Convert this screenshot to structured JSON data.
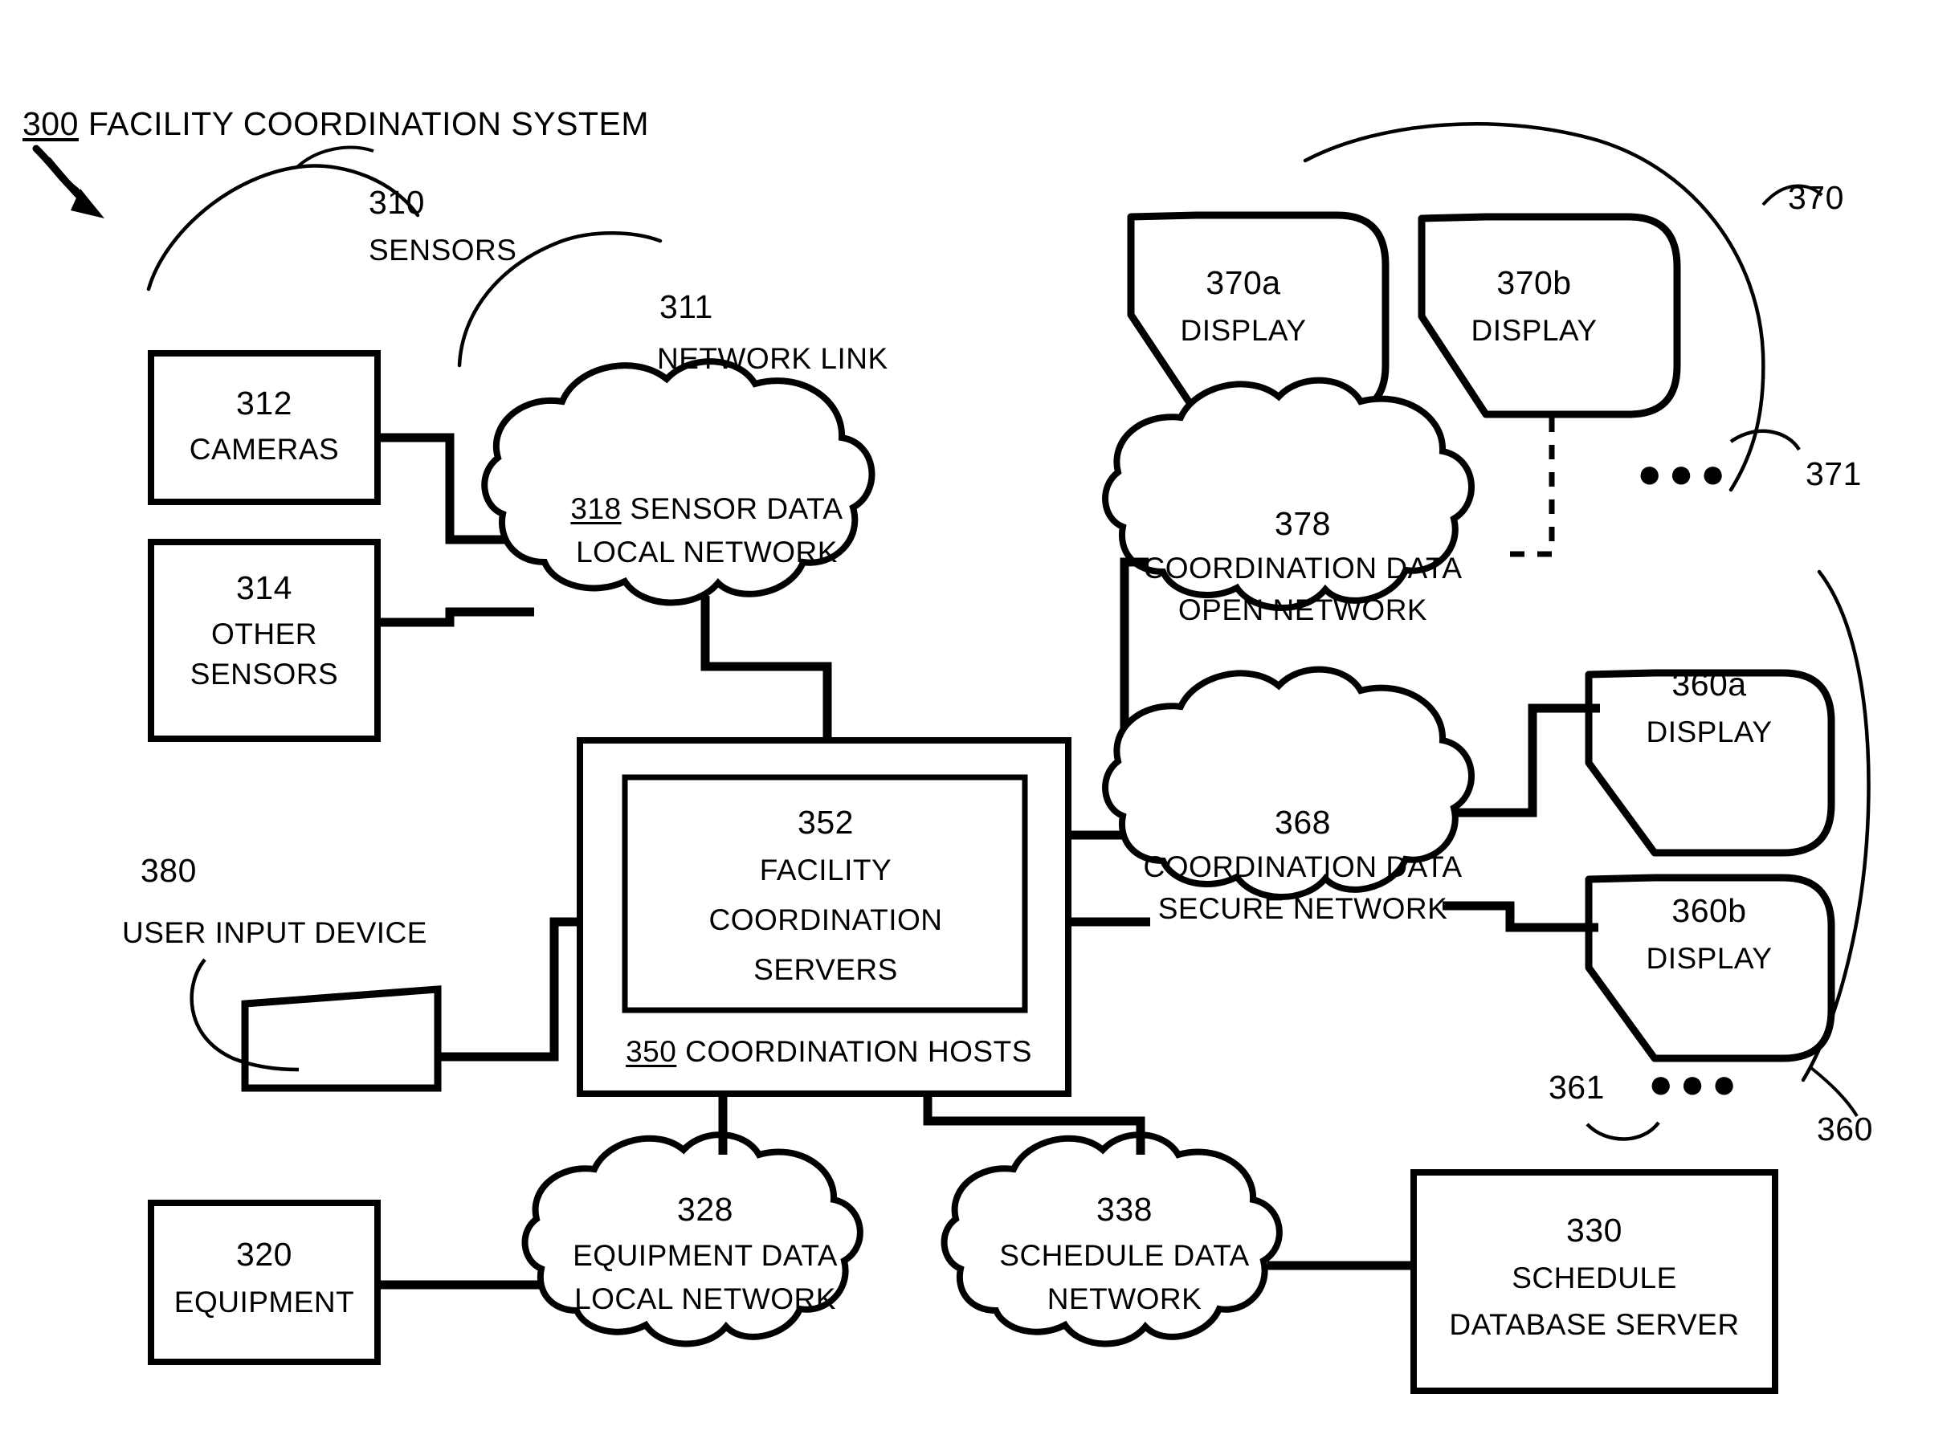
{
  "figure": {
    "system_ref": "300",
    "system_title": "FACILITY COORDINATION SYSTEM"
  },
  "groups": {
    "sensors": {
      "ref": "310",
      "label": "SENSORS"
    },
    "network_link": {
      "ref": "311",
      "label": "NETWORK LINK"
    },
    "displays_open": {
      "ref": "370",
      "ellipsis_ref": "371",
      "ellipsis": "●●●"
    },
    "displays_secure": {
      "ref": "360",
      "ellipsis_ref": "361",
      "ellipsis": "●●●"
    }
  },
  "nodes": {
    "cameras": {
      "ref": "312",
      "lines": [
        "CAMERAS"
      ]
    },
    "other_sensors": {
      "ref": "314",
      "lines": [
        "OTHER",
        "SENSORS"
      ]
    },
    "sensor_net": {
      "ref": "318",
      "lines": [
        "SENSOR DATA",
        "LOCAL NETWORK"
      ],
      "inline_ref": true
    },
    "hosts": {
      "ref": "350",
      "lines": [
        "COORDINATION HOSTS"
      ],
      "inline_ref": true
    },
    "servers": {
      "ref": "352",
      "lines": [
        "FACILITY",
        "COORDINATION",
        "SERVERS"
      ]
    },
    "user_input": {
      "ref": "380",
      "lines": [
        "USER INPUT DEVICE"
      ]
    },
    "display_370a": {
      "ref": "370a",
      "lines": [
        "DISPLAY"
      ]
    },
    "display_370b": {
      "ref": "370b",
      "lines": [
        "DISPLAY"
      ]
    },
    "display_360a": {
      "ref": "360a",
      "lines": [
        "DISPLAY"
      ]
    },
    "display_360b": {
      "ref": "360b",
      "lines": [
        "DISPLAY"
      ]
    },
    "open_net": {
      "ref": "378",
      "lines": [
        "COORDINATION DATA",
        "OPEN NETWORK"
      ]
    },
    "secure_net": {
      "ref": "368",
      "lines": [
        "COORDINATION DATA",
        "SECURE NETWORK"
      ]
    },
    "equipment": {
      "ref": "320",
      "lines": [
        "EQUIPMENT"
      ]
    },
    "equipment_net": {
      "ref": "328",
      "lines": [
        "EQUIPMENT DATA",
        "LOCAL NETWORK"
      ]
    },
    "schedule_net": {
      "ref": "338",
      "lines": [
        "SCHEDULE DATA",
        "NETWORK"
      ]
    },
    "schedule_db": {
      "ref": "330",
      "lines": [
        "SCHEDULE",
        "DATABASE SERVER"
      ]
    }
  },
  "style": {
    "ink": "#000000",
    "paper": "#ffffff"
  }
}
